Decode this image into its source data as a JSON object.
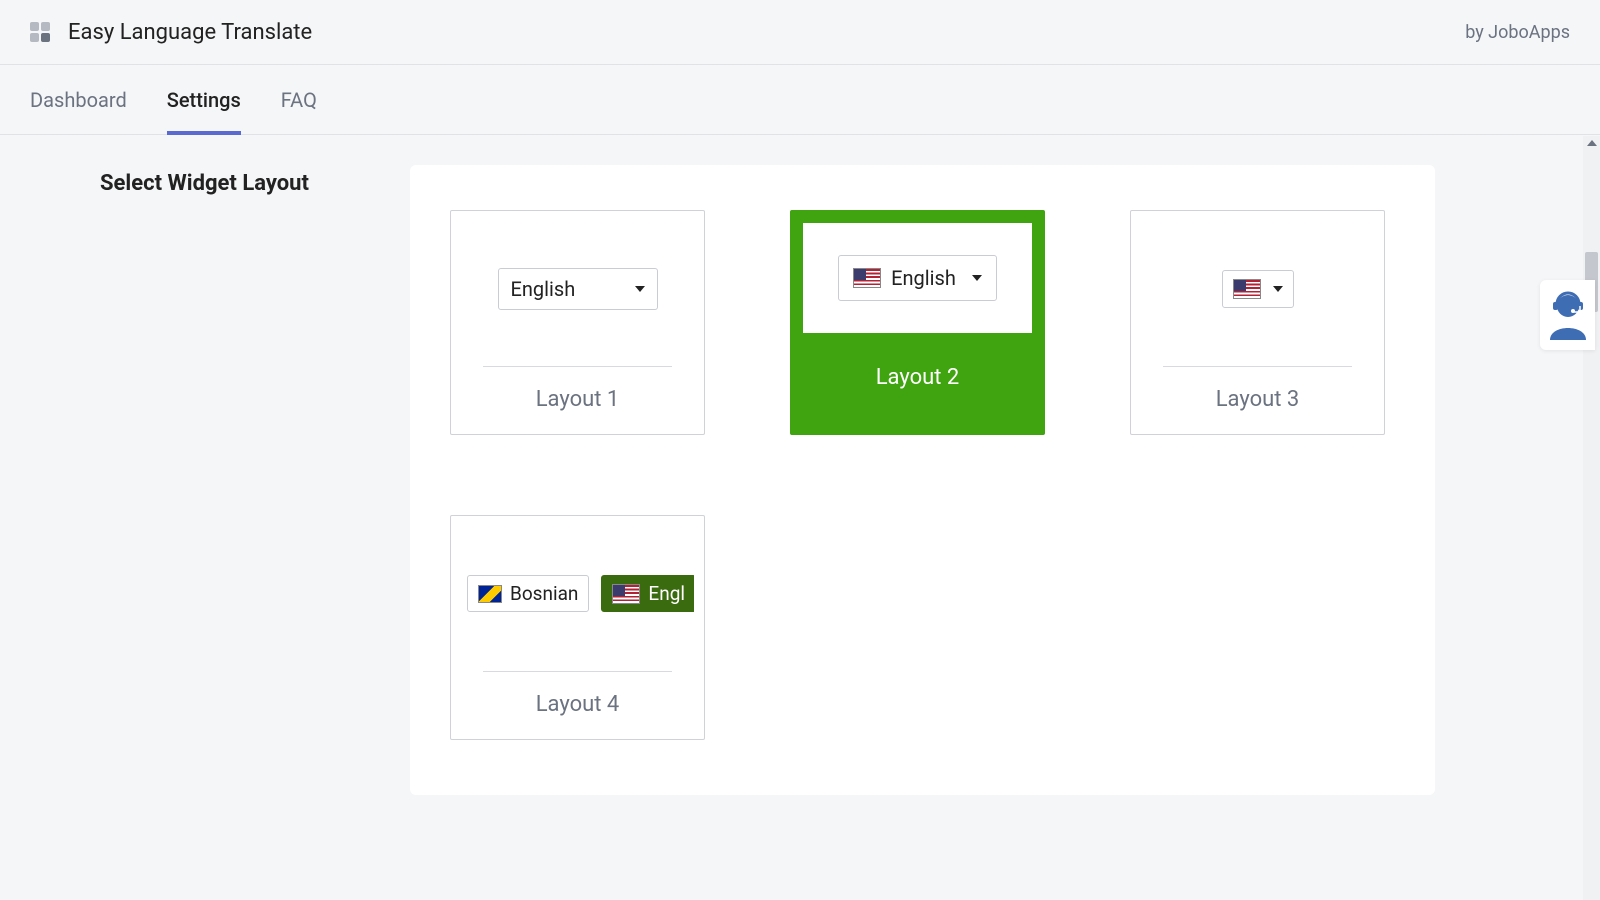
{
  "header": {
    "title": "Easy Language Translate",
    "vendor": "by JoboApps"
  },
  "tabs": {
    "dashboard": "Dashboard",
    "settings": "Settings",
    "faq": "FAQ",
    "active": "settings"
  },
  "section": {
    "title": "Select Widget Layout"
  },
  "layouts": {
    "l1": {
      "label": "Layout 1",
      "dropdown_text": "English"
    },
    "l2": {
      "label": "Layout 2",
      "dropdown_text": "English",
      "selected": true
    },
    "l3": {
      "label": "Layout 3"
    },
    "l4": {
      "label": "Layout 4",
      "chip1": "Bosnian",
      "chip2": "Engl"
    }
  },
  "colors": {
    "accent_selected": "#3fa40f",
    "tab_underline": "#5b6ad0",
    "support_icon": "#3f6db3"
  }
}
